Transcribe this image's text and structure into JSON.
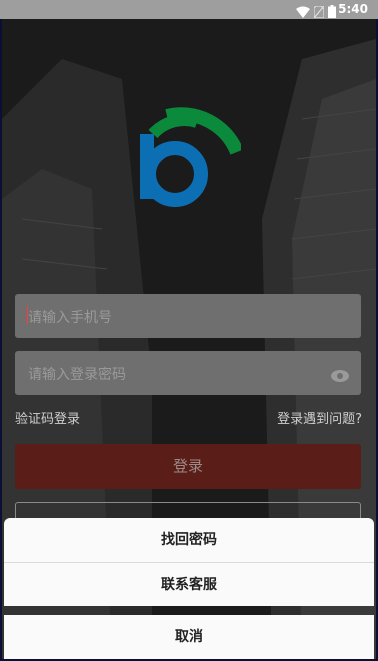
{
  "status_bar": {
    "time": "5:40",
    "icons": [
      "wifi-icon",
      "no-sim-icon",
      "battery-icon"
    ]
  },
  "login": {
    "phone_placeholder": "请输入手机号",
    "password_placeholder": "请输入登录密码",
    "sms_login_link": "验证码登录",
    "problem_link": "登录遇到问题?",
    "login_button": "登录"
  },
  "action_sheet": {
    "items": [
      "找回密码",
      "联系客服"
    ],
    "cancel": "取消"
  },
  "colors": {
    "logo_green": "#0a8a3a",
    "logo_blue": "#0d6fb3",
    "login_button_bg": "#5a1d18"
  }
}
